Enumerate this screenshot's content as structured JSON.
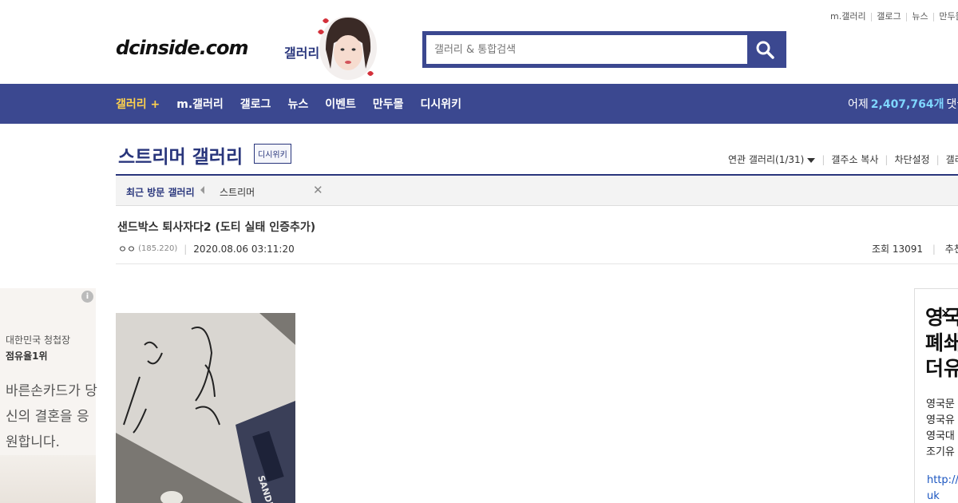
{
  "top_links": [
    "m.갤러리",
    "갤로그",
    "뉴스",
    "만두몰"
  ],
  "logo": {
    "text": "dcinside.com",
    "sub": "갤러리"
  },
  "search": {
    "placeholder": "갤러리 & 통합검색"
  },
  "gnb": {
    "items": [
      "갤러리 +",
      "m.갤러리",
      "갤로그",
      "뉴스",
      "이벤트",
      "만두몰",
      "디시위키"
    ],
    "stats_prefix": "어제",
    "stats_value": "2,407,764개",
    "stats_suffix": "댓글"
  },
  "gallery": {
    "title": "스트리머 갤러리",
    "wiki_badge": "디시위키",
    "options": [
      "연관 갤러리(1/31)",
      "갤주소 복사",
      "차단설정",
      "갤러리"
    ]
  },
  "recent": {
    "label": "최근 방문 갤러리",
    "items": [
      "스트리머"
    ]
  },
  "post": {
    "title": "샌드박스 퇴사자다2 (도티 실태 인증추가)",
    "author": "ㅇㅇ",
    "ip": "(185.220)",
    "date": "2020.08.06 03:11:20",
    "views": "조회 13091",
    "recommend": "추천"
  },
  "ad_left": {
    "line1": "대한민국 청첩장",
    "line2": "점유율1위",
    "line3": "바른손카드가 당신의 결혼을 응원합니다."
  },
  "ad_right": {
    "title": "영국 폐쇄 더유",
    "body": [
      "영국문",
      "영국유",
      "영국대",
      "조기유"
    ],
    "link": [
      "http://t",
      "uk"
    ]
  },
  "colors": {
    "brand": "#3b4890",
    "nav_active": "#ffd24d",
    "stats": "#7fd7ff"
  }
}
